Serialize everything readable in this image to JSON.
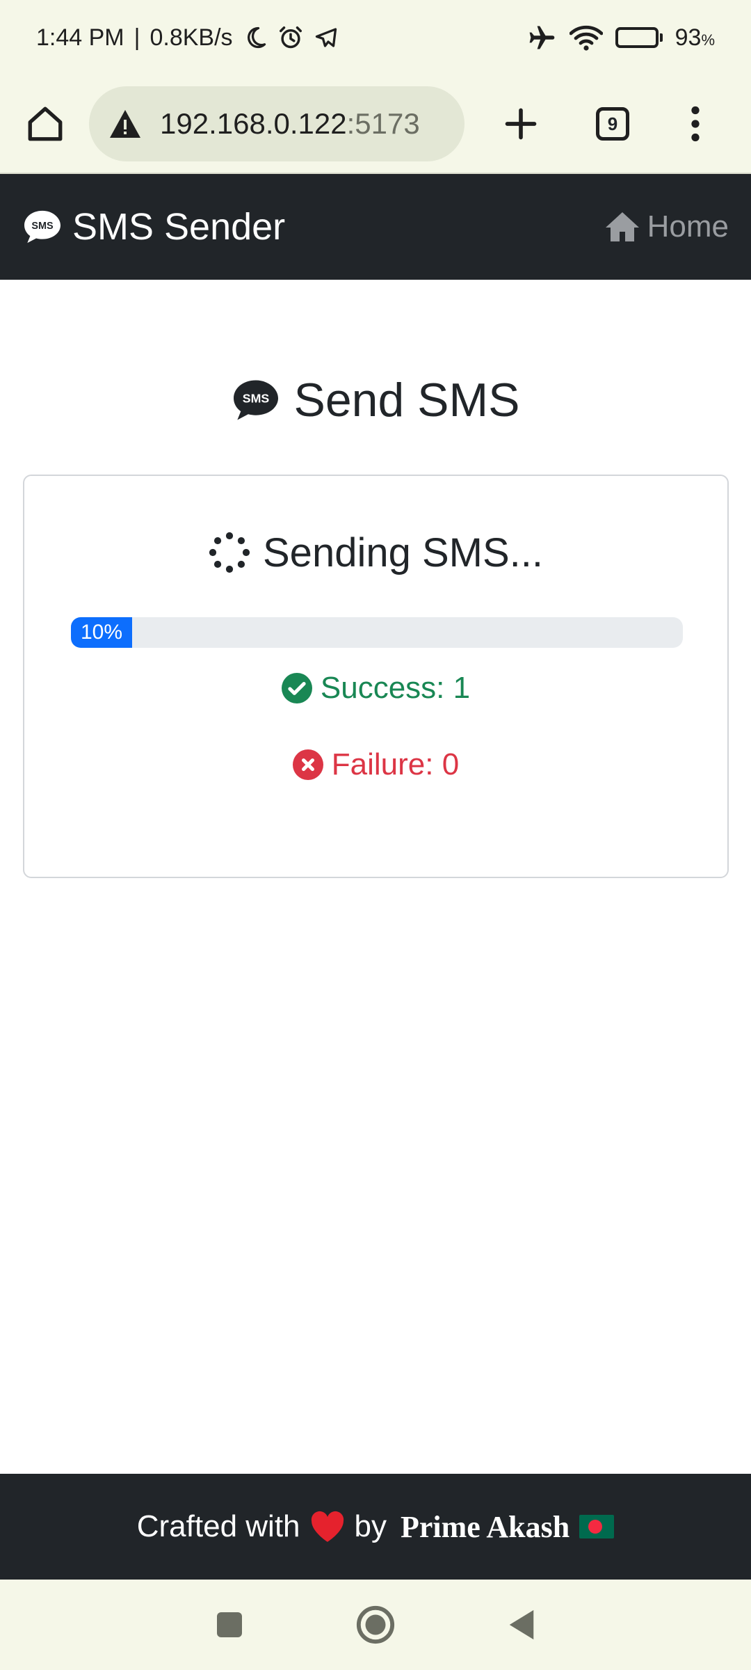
{
  "status_bar": {
    "time": "1:44 PM",
    "separator": "|",
    "speed": "0.8KB/s",
    "battery_percent": "93",
    "battery_unit": "%",
    "battery_level": 0.93
  },
  "browser": {
    "url_host": "192.168.0.122",
    "url_port": ":5173",
    "tab_count": "9"
  },
  "navbar": {
    "brand": "SMS Sender",
    "home_label": "Home"
  },
  "main": {
    "title": "Send SMS",
    "status_text": "Sending SMS...",
    "progress_label": "10%",
    "progress_value": 0.1,
    "success_text": "Success: 1",
    "failure_text": "Failure: 0"
  },
  "footer": {
    "prefix": "Crafted with",
    "by": "by",
    "author": "Prime Akash"
  },
  "colors": {
    "primary": "#0d6efd",
    "success": "#198754",
    "danger": "#dc3545",
    "dark": "#212529",
    "heart": "#e5222d",
    "flag_green": "#006a4e",
    "flag_red": "#f42a41"
  },
  "icons": {
    "sms": "sms-chat-bubble",
    "home": "house",
    "spinner": "dotted-spinner",
    "success": "check-circle",
    "failure": "x-circle",
    "heart": "heart",
    "flag": "bangladesh-flag"
  }
}
